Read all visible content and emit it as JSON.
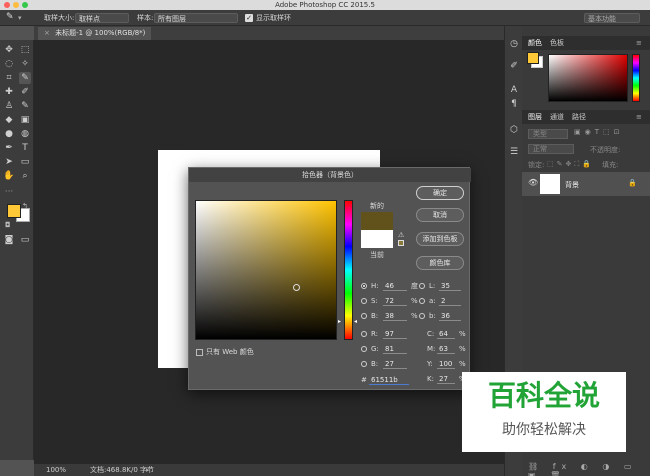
{
  "app": {
    "title": "Adobe Photoshop CC 2015.5"
  },
  "options_bar": {
    "sample_size_label": "取样大小:",
    "sample_size_value": "取样点",
    "sample_label": "样本:",
    "sample_value": "所有图层",
    "show_ring_label": "显示取样环",
    "workspace_value": "基本功能"
  },
  "document_tab": {
    "title": "未标题-1 @ 100%(RGB/8*)"
  },
  "status_bar": {
    "zoom": "100%",
    "doc_info": "文档:468.8K/0 字节"
  },
  "colors": {
    "foreground": "#ffc836",
    "background": "#ffffff",
    "picker_new": "#61511b",
    "picker_current": "#ffffff"
  },
  "color_panel": {
    "tab_color": "颜色",
    "tab_swatches": "色板"
  },
  "layers_panel": {
    "tab_layers": "图层",
    "tab_channels": "通道",
    "tab_paths": "路径",
    "filter_kind": "类型",
    "blend_mode": "正常",
    "opacity_label": "不透明度:",
    "lock_label": "锁定:",
    "fill_label": "填充:",
    "layer_name": "背景"
  },
  "picker": {
    "title": "拾色器（背景色）",
    "new_label": "新的",
    "current_label": "当前",
    "ok": "确定",
    "cancel": "取消",
    "add_swatch": "添加到色板",
    "libraries": "颜色库",
    "web_only": "只有 Web 颜色",
    "H": {
      "label": "H:",
      "value": "46",
      "unit": "度"
    },
    "S": {
      "label": "S:",
      "value": "72",
      "unit": "%"
    },
    "B": {
      "label": "B:",
      "value": "38",
      "unit": "%"
    },
    "R": {
      "label": "R:",
      "value": "97"
    },
    "G": {
      "label": "G:",
      "value": "81"
    },
    "Bb": {
      "label": "B:",
      "value": "27"
    },
    "L": {
      "label": "L:",
      "value": "35"
    },
    "a": {
      "label": "a:",
      "value": "2"
    },
    "b": {
      "label": "b:",
      "value": "36"
    },
    "C": {
      "label": "C:",
      "value": "64",
      "unit": "%"
    },
    "M": {
      "label": "M:",
      "value": "63",
      "unit": "%"
    },
    "Y": {
      "label": "Y:",
      "value": "100",
      "unit": "%"
    },
    "K": {
      "label": "K:",
      "value": "27",
      "unit": "%"
    },
    "hex_label": "#",
    "hex": "61511b"
  },
  "watermark": {
    "title": "百科全说",
    "subtitle": "助你轻松解决"
  }
}
